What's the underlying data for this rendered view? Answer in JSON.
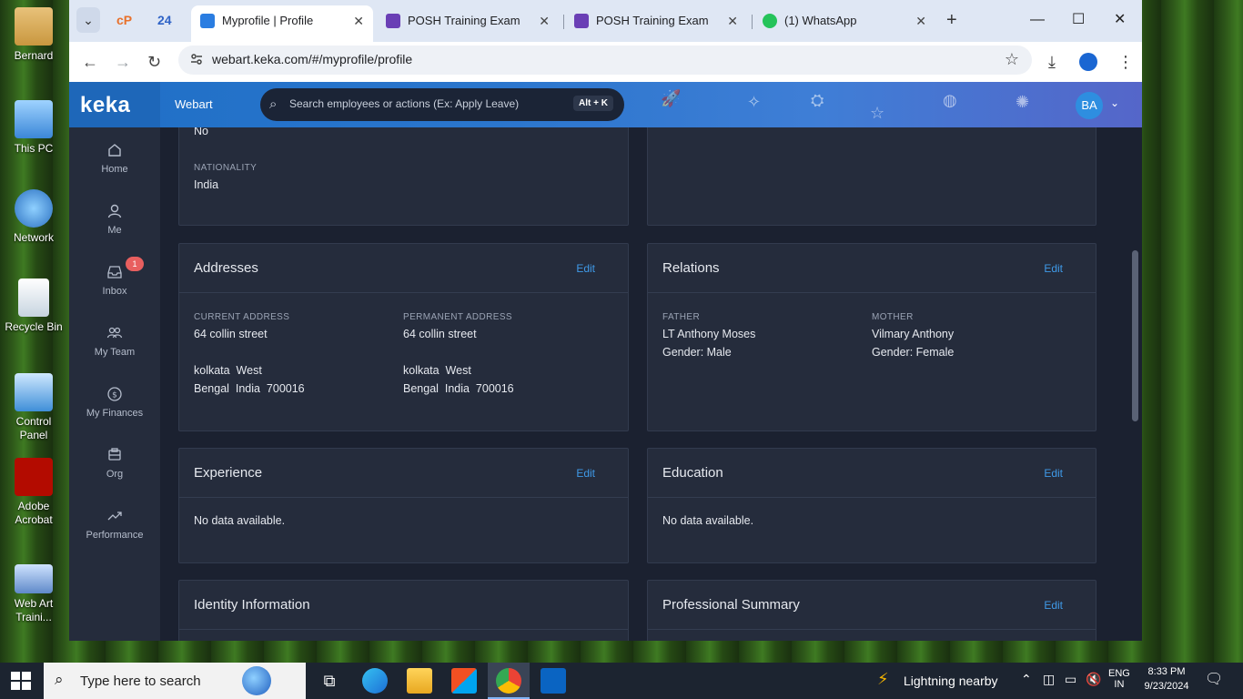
{
  "desktop": {
    "icons": [
      {
        "label": "Bernard",
        "icon": "user-folder-icon"
      },
      {
        "label": "This PC",
        "icon": "computer-icon"
      },
      {
        "label": "Network",
        "icon": "network-icon"
      },
      {
        "label": "Recycle Bin",
        "icon": "recycle-bin-icon"
      },
      {
        "label": "Control Panel",
        "icon": "control-panel-icon"
      },
      {
        "label": "Adobe Acrobat",
        "icon": "adobe-acrobat-icon"
      },
      {
        "label": "Web Art Traini...",
        "icon": "powerpoint-file-icon"
      }
    ]
  },
  "browser": {
    "pinned_tab_1": "cP",
    "pinned_tab_2": "24",
    "tabs": [
      {
        "title": "Myprofile | Profile",
        "active": true
      },
      {
        "title": "POSH Training Exam"
      },
      {
        "title": "POSH Training Exam"
      },
      {
        "title": "(1) WhatsApp"
      }
    ],
    "url": "webart.keka.com/#/myprofile/profile"
  },
  "keka": {
    "logo": "keka",
    "brand": "Webart",
    "search_placeholder": "Search employees or actions (Ex: Apply Leave)",
    "search_shortcut": "Alt + K",
    "avatar_initials": "BA",
    "nav": [
      {
        "label": "Home"
      },
      {
        "label": "Me"
      },
      {
        "label": "Inbox",
        "badge": "1"
      },
      {
        "label": "My Team"
      },
      {
        "label": "My Finances"
      },
      {
        "label": "Org"
      },
      {
        "label": "Performance"
      }
    ]
  },
  "profile": {
    "top_card": {
      "prev_value": "No",
      "nationality_label": "NATIONALITY",
      "nationality": "India"
    },
    "addresses": {
      "title": "Addresses",
      "edit": "Edit",
      "current_label": "CURRENT ADDRESS",
      "current_line1": "64 collin street",
      "current_line2": "kolkata  West",
      "current_line3": "Bengal  India  700016",
      "permanent_label": "PERMANENT ADDRESS",
      "permanent_line1": "64 collin street",
      "permanent_line2": "kolkata  West",
      "permanent_line3": "Bengal  India  700016"
    },
    "relations": {
      "title": "Relations",
      "edit": "Edit",
      "father_label": "FATHER",
      "father_name": "LT Anthony Moses",
      "father_gender": "Gender: Male",
      "mother_label": "MOTHER",
      "mother_name": "Vilmary Anthony",
      "mother_gender": "Gender: Female"
    },
    "experience": {
      "title": "Experience",
      "edit": "Edit",
      "empty": "No data available."
    },
    "education": {
      "title": "Education",
      "edit": "Edit",
      "empty": "No data available."
    },
    "identity": {
      "title": "Identity Information"
    },
    "summary": {
      "title": "Professional Summary",
      "edit": "Edit"
    }
  },
  "taskbar": {
    "search_placeholder": "Type here to search",
    "weather": "Lightning nearby",
    "lang_1": "ENG",
    "lang_2": "IN",
    "time": "8:33 PM",
    "date": "9/23/2024"
  },
  "colors": {
    "keka_blue": "#1f6fc6",
    "panel_bg": "#252c3c",
    "content_bg": "#1b2130",
    "link_blue": "#3f9ae8",
    "badge_red": "#e85f5f"
  }
}
